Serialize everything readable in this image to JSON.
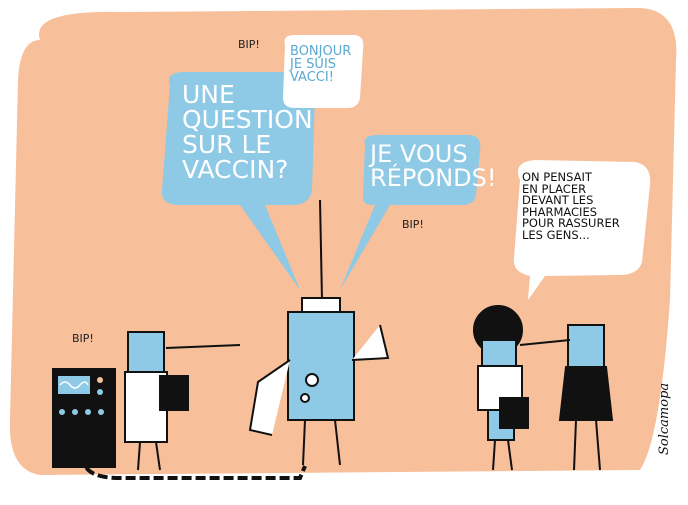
{
  "colors": {
    "background": "#f7bf9a",
    "bubble_blue": "#8ec9e6",
    "ink": "#111111",
    "white": "#ffffff"
  },
  "sounds": {
    "bip_top": "BIP!",
    "bip_right": "BIP!",
    "bip_left": "BIP!"
  },
  "bubbles": {
    "bonjour": "BONJOUR\nJE SUIS\nVACCI!",
    "question": "UNE\nQUESTION\nSUR LE\nVACCIN?",
    "reponds": "JE VOUS\nRÉPONDS!",
    "pharmacies": "ON PENSAIT\nEN PLACER\nDEVANT LES\nPHARMACIES\nPOUR RASSURER\nLES GENS..."
  },
  "signature": "Solcamopa"
}
